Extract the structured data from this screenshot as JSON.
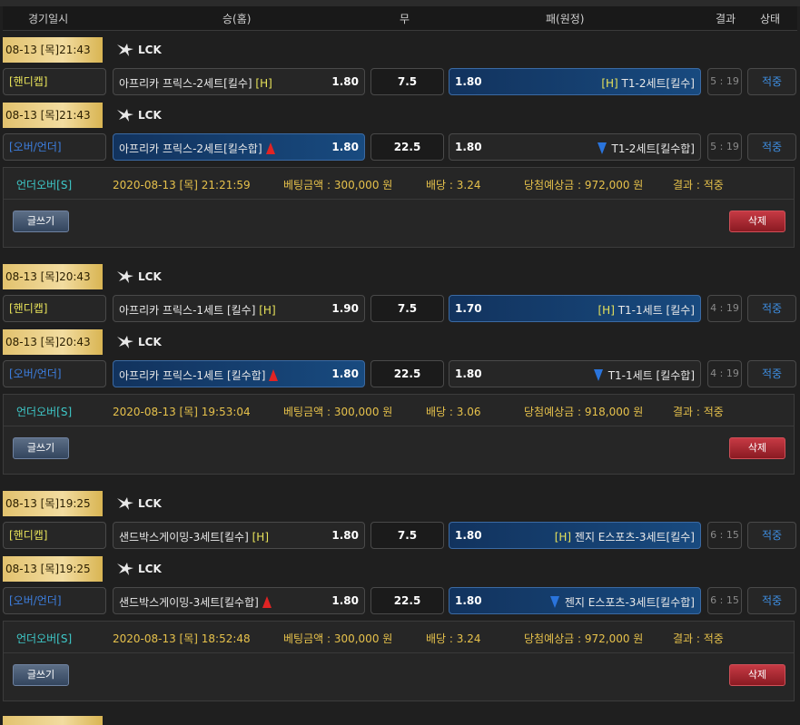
{
  "header": {
    "date": "경기일시",
    "home": "승(홈)",
    "draw": "무",
    "away": "패(원정)",
    "result": "결과",
    "status": "상태"
  },
  "icons": {
    "league": "lol-logo-icon",
    "up": "arrow-up-icon",
    "down": "arrow-down-icon"
  },
  "colors": {
    "gold": "#e2c26e",
    "selected": "#184a7f",
    "status": "#3d8de0",
    "handicap": "#e8e35a",
    "overunder": "#3d7fe0",
    "up_arrow": "#e02424",
    "down_arrow": "#2a74dc"
  },
  "bets": [
    {
      "rows": [
        {
          "date": "08-13 [목]21:43",
          "league": "LCK",
          "type": "[핸디캡]",
          "home": "아프리카 프릭스-2세트[킬수]",
          "home_mark": "[H]",
          "home_odds": "1.80",
          "draw": "7.5",
          "away_odds": "1.80",
          "away_mark": "[H]",
          "away": "T1-2세트[킬수]",
          "score": "5 : 19",
          "status": "적중"
        },
        {
          "date": "08-13 [목]21:43",
          "league": "LCK",
          "type": "[오버/언더]",
          "home": "아프리카 프릭스-2세트[킬수합]",
          "home_odds": "1.80",
          "draw": "22.5",
          "away_odds": "1.80",
          "away": "T1-2세트[킬수합]",
          "score": "5 : 19",
          "status": "적중"
        }
      ],
      "summary": {
        "type": "언더오버[S]",
        "datetime": "2020-08-13 [목] 21:21:59",
        "amount": "베팅금액 : 300,000 원",
        "odds": "배당 : 3.24",
        "expected": "당첨예상금 : 972,000 원",
        "result": "결과 : 적중",
        "write_btn": "글쓰기",
        "delete_btn": "삭제"
      }
    },
    {
      "rows": [
        {
          "date": "08-13 [목]20:43",
          "league": "LCK",
          "type": "[핸디캡]",
          "home": "아프리카 프릭스-1세트 [킬수]",
          "home_mark": "[H]",
          "home_odds": "1.90",
          "draw": "7.5",
          "away_odds": "1.70",
          "away_mark": "[H]",
          "away": "T1-1세트 [킬수]",
          "score": "4 : 19",
          "status": "적중"
        },
        {
          "date": "08-13 [목]20:43",
          "league": "LCK",
          "type": "[오버/언더]",
          "home": "아프리카 프릭스-1세트 [킬수합]",
          "home_odds": "1.80",
          "draw": "22.5",
          "away_odds": "1.80",
          "away": "T1-1세트 [킬수합]",
          "score": "4 : 19",
          "status": "적중"
        }
      ],
      "summary": {
        "type": "언더오버[S]",
        "datetime": "2020-08-13 [목] 19:53:04",
        "amount": "베팅금액 : 300,000 원",
        "odds": "배당 : 3.06",
        "expected": "당첨예상금 : 918,000 원",
        "result": "결과 : 적중",
        "write_btn": "글쓰기",
        "delete_btn": "삭제"
      }
    },
    {
      "rows": [
        {
          "date": "08-13 [목]19:25",
          "league": "LCK",
          "type": "[핸디캡]",
          "home": "샌드박스게이밍-3세트[킬수]",
          "home_mark": "[H]",
          "home_odds": "1.80",
          "draw": "7.5",
          "away_odds": "1.80",
          "away_mark": "[H]",
          "away": "젠지 E스포츠-3세트[킬수]",
          "score": "6 : 15",
          "status": "적중"
        },
        {
          "date": "08-13 [목]19:25",
          "league": "LCK",
          "type": "[오버/언더]",
          "home": "샌드박스게이밍-3세트[킬수합]",
          "home_odds": "1.80",
          "draw": "22.5",
          "away_odds": "1.80",
          "away": "젠지 E스포츠-3세트[킬수합]",
          "score": "6 : 15",
          "status": "적중"
        }
      ],
      "summary": {
        "type": "언더오버[S]",
        "datetime": "2020-08-13 [목] 18:52:48",
        "amount": "베팅금액 : 300,000 원",
        "odds": "배당 : 3.24",
        "expected": "당첨예상금 : 972,000 원",
        "result": "결과 : 적중",
        "write_btn": "글쓰기",
        "delete_btn": "삭제"
      }
    }
  ]
}
